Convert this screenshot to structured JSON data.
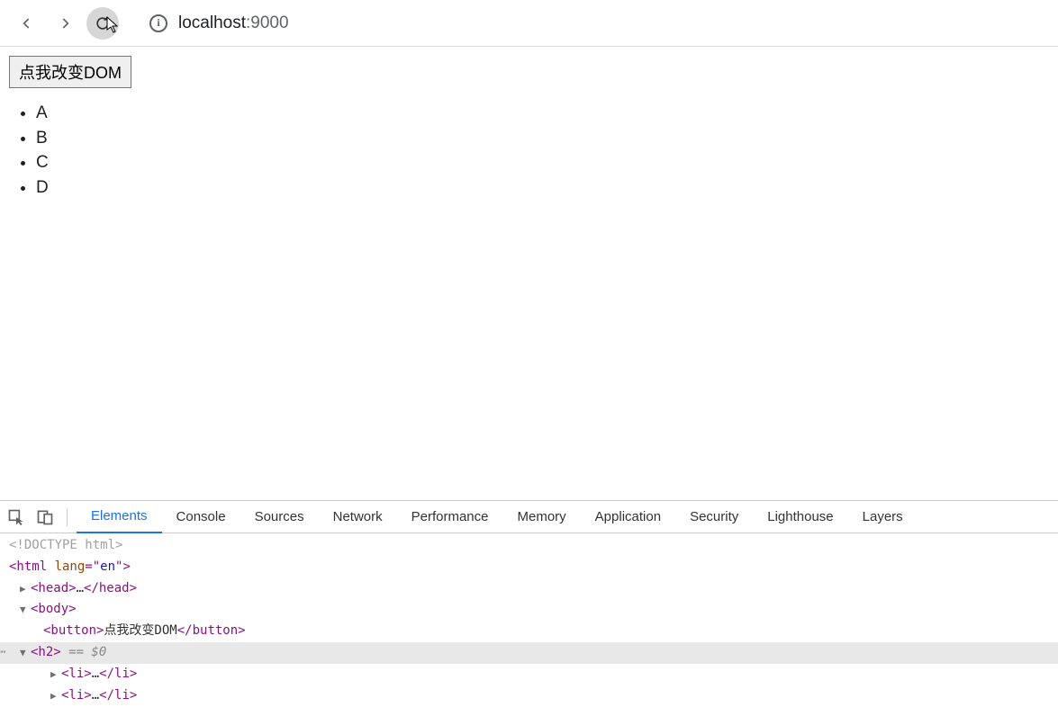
{
  "toolbar": {
    "url_host": "localhost",
    "url_port": ":9000"
  },
  "page": {
    "button_label": "点我改变DOM",
    "items": [
      "A",
      "B",
      "C",
      "D"
    ]
  },
  "devtools": {
    "tabs": [
      "Elements",
      "Console",
      "Sources",
      "Network",
      "Performance",
      "Memory",
      "Application",
      "Security",
      "Lighthouse",
      "Layers"
    ],
    "active_tab": 0,
    "dom": {
      "doctype": "<!DOCTYPE html>",
      "html_open": "<html ",
      "html_attr_name": "lang",
      "html_attr_eq": "=\"",
      "html_attr_val": "en",
      "html_attr_close": "\">",
      "head_open": "<head>",
      "ellipsis": "…",
      "head_close": "</head>",
      "body_open": "<body>",
      "button_open": "<button>",
      "button_text": "点我改变DOM",
      "button_close": "</button>",
      "h2_open": "<h2>",
      "selected_suffix": " == $0",
      "li_open": "<li>",
      "li_close": "</li>"
    }
  }
}
